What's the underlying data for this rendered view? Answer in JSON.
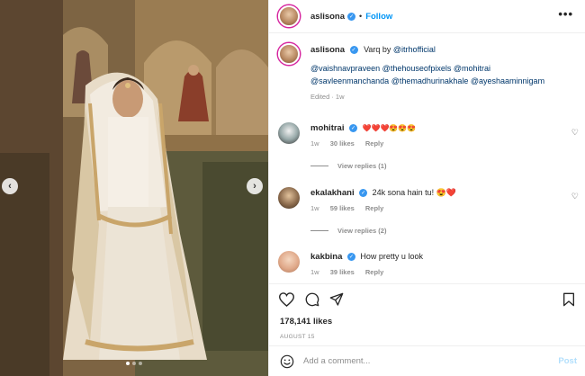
{
  "post": {
    "username": "aslisona",
    "follow_label": "Follow",
    "more_label": "•••",
    "sep": "•"
  },
  "caption": {
    "username": "aslisona",
    "text_prefix": "Varq by ",
    "brand_mention": "@itrhofficial",
    "mentions_line1": "@vaishnavpraveen @thehouseofpixels @mohitrai",
    "mentions_line2": "@savleenmanchanda @themadhurinakhale @ayeshaaminnigam",
    "edited": "Edited · 1w"
  },
  "comments": [
    {
      "username": "mohitrai",
      "text": "❤️❤️❤️😍😍😍",
      "time": "1w",
      "likes": "30 likes",
      "reply_label": "Reply",
      "view_replies": "View replies (1)"
    },
    {
      "username": "ekalakhani",
      "text": "24k sona hain tu! 😍❤️",
      "time": "1w",
      "likes": "59 likes",
      "reply_label": "Reply",
      "view_replies": "View replies (2)"
    },
    {
      "username": "kakbina",
      "text": "How pretty u look",
      "time": "1w",
      "likes": "39 likes",
      "reply_label": "Reply"
    }
  ],
  "stats": {
    "likes": "178,141 likes",
    "date": "AUGUST 15"
  },
  "add_comment": {
    "placeholder": "Add a comment...",
    "post_label": "Post"
  },
  "carousel": {
    "prev_glyph": "‹",
    "next_glyph": "›",
    "slides": 3,
    "active_slide": 1
  },
  "colors": {
    "link": "#0095f6",
    "mention": "#00376b",
    "verified": "#3897f0",
    "muted": "#8e8e8e",
    "post_disabled": "#b2dffc"
  },
  "icons": [
    "heart-icon",
    "comment-icon",
    "share-icon",
    "bookmark-icon",
    "emoji-icon",
    "more-icon",
    "verified-icon"
  ]
}
